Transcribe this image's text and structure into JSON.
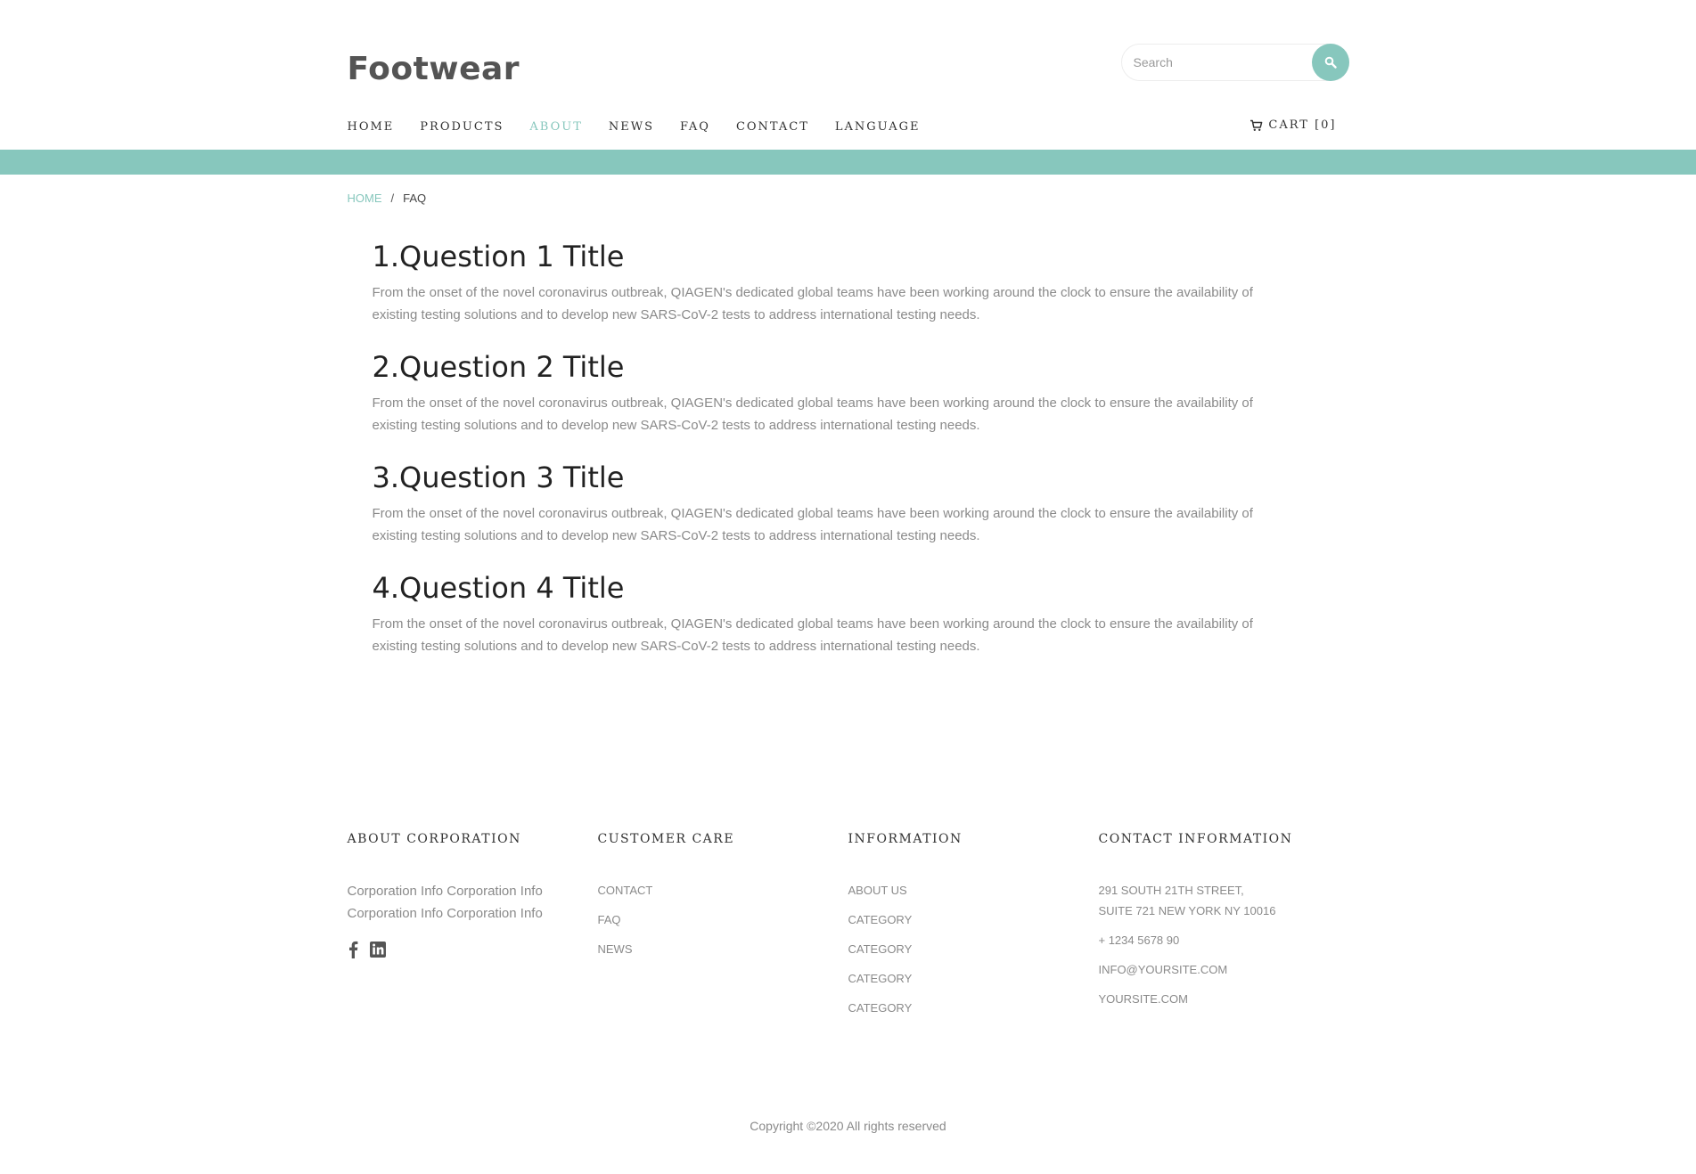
{
  "header": {
    "logo": "Footwear",
    "search_placeholder": "Search",
    "nav": [
      {
        "label": "HOME",
        "active": false
      },
      {
        "label": "PRODUCTS",
        "active": false
      },
      {
        "label": "ABOUT",
        "active": true
      },
      {
        "label": "NEWS",
        "active": false
      },
      {
        "label": "FAQ",
        "active": false
      },
      {
        "label": "CONTACT",
        "active": false
      },
      {
        "label": "LANGUAGE",
        "active": false
      }
    ],
    "cart_label": "CART [0]"
  },
  "breadcrumb": {
    "home": "HOME",
    "separator": "/",
    "current": "FAQ"
  },
  "faq": [
    {
      "title": "1.Question 1 Title",
      "body": "From the onset of the novel coronavirus outbreak, QIAGEN's dedicated global teams have been working around the clock to ensure the availability of existing testing solutions and to develop new SARS-CoV-2 tests to address international testing needs."
    },
    {
      "title": "2.Question 2 Title",
      "body": "From the onset of the novel coronavirus outbreak, QIAGEN's dedicated global teams have been working around the clock to ensure the availability of existing testing solutions and to develop new SARS-CoV-2 tests to address international testing needs."
    },
    {
      "title": "3.Question 3 Title",
      "body": "From the onset of the novel coronavirus outbreak, QIAGEN's dedicated global teams have been working around the clock to ensure the availability of existing testing solutions and to develop new SARS-CoV-2 tests to address international testing needs."
    },
    {
      "title": "4.Question 4 Title",
      "body": "From the onset of the novel coronavirus outbreak, QIAGEN's dedicated global teams have been working around the clock to ensure the availability of existing testing solutions and to develop new SARS-CoV-2 tests to address international testing needs."
    }
  ],
  "footer": {
    "about": {
      "heading": "ABOUT CORPORATION",
      "text": "Corporation Info Corporation Info Corporation Info Corporation Info",
      "social_icons": [
        "facebook-icon",
        "linkedin-icon"
      ]
    },
    "customer_care": {
      "heading": "CUSTOMER CARE",
      "links": [
        "CONTACT",
        "FAQ",
        "NEWS"
      ]
    },
    "information": {
      "heading": "INFORMATION",
      "links": [
        "ABOUT US",
        "CATEGORY",
        "CATEGORY",
        "CATEGORY",
        "CATEGORY"
      ]
    },
    "contact": {
      "heading": "CONTACT INFORMATION",
      "address_line1": "291 SOUTH 21TH STREET,",
      "address_line2": "SUITE 721 NEW YORK NY 10016",
      "phone": "+ 1234 5678 90",
      "email": "INFO@YOURSITE.COM",
      "website": "YOURSITE.COM"
    },
    "copyright": "Copyright ©2020 All rights reserved"
  },
  "colors": {
    "accent": "#87c7bd",
    "text_dark": "#333333",
    "text_muted": "#8a8a8a"
  }
}
